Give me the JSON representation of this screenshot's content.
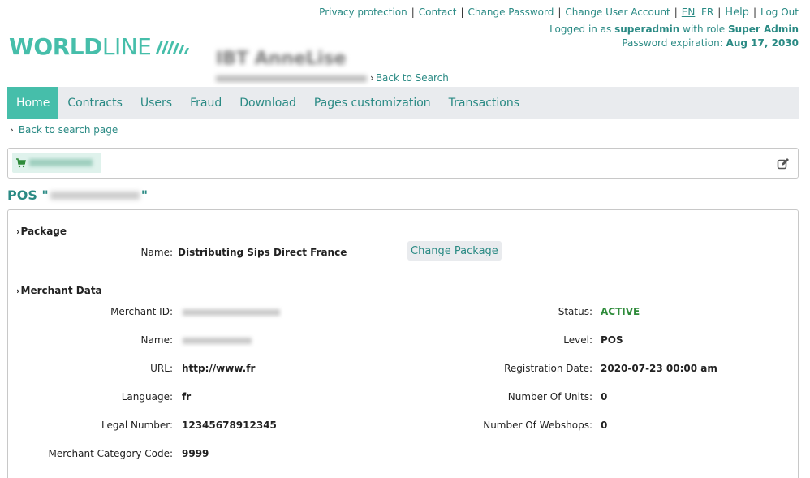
{
  "top_links": {
    "privacy": "Privacy protection",
    "contact": "Contact",
    "change_password": "Change Password",
    "change_user_account": "Change User Account",
    "lang_en": "EN",
    "lang_fr": "FR",
    "help": "Help",
    "logout": "Log Out"
  },
  "login": {
    "prefix": "Logged in as ",
    "user": "superadmin",
    "role_prefix": " with role ",
    "role": "Super Admin",
    "pwd_prefix": "Password expiration: ",
    "pwd_date": "Aug 17, 2030"
  },
  "logo": {
    "bold": "WORLD",
    "light": "LINE"
  },
  "header": {
    "entity_name": "IBT AnneLise",
    "back_to_search": "Back to Search"
  },
  "nav": {
    "items": [
      {
        "label": "Home",
        "active": true
      },
      {
        "label": "Contracts"
      },
      {
        "label": "Users"
      },
      {
        "label": "Fraud"
      },
      {
        "label": "Download"
      },
      {
        "label": "Pages customization"
      },
      {
        "label": "Transactions"
      }
    ]
  },
  "back_page": "Back to search page",
  "pos_title": {
    "prefix": "POS \"",
    "suffix": "\""
  },
  "package": {
    "title": "Package",
    "name_label": "Name:",
    "name_value": "Distributing Sips Direct France",
    "change_button": "Change Package"
  },
  "merchant": {
    "title": "Merchant Data",
    "left": [
      {
        "label": "Merchant ID:",
        "value": ""
      },
      {
        "label": "Name:",
        "value": ""
      },
      {
        "label": "URL:",
        "value": "http://www.fr"
      },
      {
        "label": "Language:",
        "value": "fr"
      },
      {
        "label": "Legal Number:",
        "value": "12345678912345"
      },
      {
        "label": "Merchant Category Code:",
        "value": "9999"
      }
    ],
    "right": [
      {
        "label": "Status:",
        "value": "ACTIVE"
      },
      {
        "label": "Level:",
        "value": "POS"
      },
      {
        "label": "Registration Date:",
        "value": "2020-07-23 00:00 am"
      },
      {
        "label": "Number Of Units:",
        "value": "0"
      },
      {
        "label": "Number Of Webshops:",
        "value": "0"
      }
    ]
  },
  "colors": {
    "brand": "#46beaa",
    "link": "#2a8a84",
    "active_status": "#2e8b3a",
    "nav_bg": "#e9ebee"
  },
  "icons": {
    "cart": "cart-icon",
    "edit": "edit-icon",
    "chevron": "chevron-right-icon"
  }
}
